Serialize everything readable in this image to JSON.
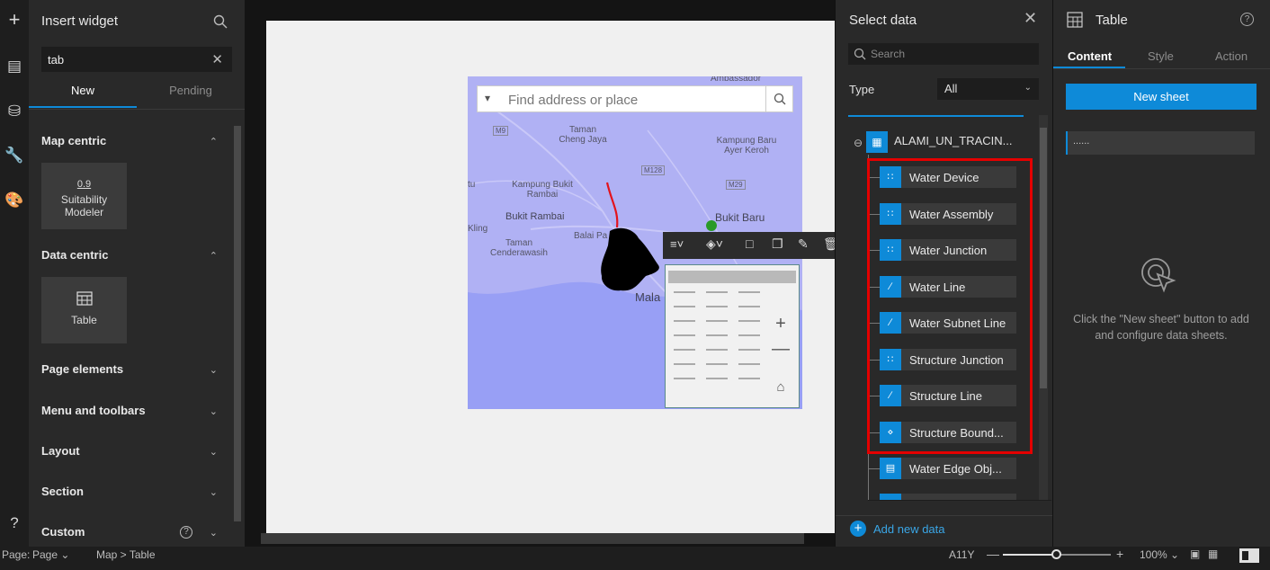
{
  "rail": {
    "icons": [
      "plus-icon",
      "page-icon",
      "data-icon",
      "tools-icon",
      "theme-icon",
      "help-icon"
    ]
  },
  "widget_panel": {
    "title": "Insert widget",
    "search_value": "tab",
    "tabs": [
      {
        "label": "New"
      },
      {
        "label": "Pending"
      }
    ],
    "sections": [
      {
        "label": "Map centric"
      },
      {
        "label": "Data centric"
      },
      {
        "label": "Page elements"
      },
      {
        "label": "Menu and toolbars"
      },
      {
        "label": "Layout"
      },
      {
        "label": "Section"
      },
      {
        "label": "Custom"
      }
    ],
    "tiles": [
      {
        "label": "Suitability Modeler",
        "icon_text": "0.9"
      },
      {
        "label": "Table"
      }
    ]
  },
  "map": {
    "search_placeholder": "Find address or place",
    "labels": [
      "Ambassador",
      "Taman Cheng Jaya",
      "Kampung Baru Ayer Keroh",
      "M9",
      "M128",
      "M29",
      "Kampung Bukit Rambai",
      "Bukit Rambai",
      "Bukit Baru",
      "Taman Cenderawasih",
      "Balai Pa",
      "Kling",
      "tu",
      "Mala"
    ]
  },
  "select_panel": {
    "title": "Select data",
    "search_placeholder": "Search",
    "type_label": "Type",
    "type_value": "All",
    "root_layer": "ALAMI_UN_TRACIN...",
    "layers": [
      {
        "label": "Water Device",
        "icon": "point-icon"
      },
      {
        "label": "Water Assembly",
        "icon": "point-icon"
      },
      {
        "label": "Water Junction",
        "icon": "point-icon"
      },
      {
        "label": "Water Line",
        "icon": "line-icon"
      },
      {
        "label": "Water Subnet Line",
        "icon": "line-icon"
      },
      {
        "label": "Structure Junction",
        "icon": "point-icon"
      },
      {
        "label": "Structure Line",
        "icon": "line-icon"
      },
      {
        "label": "Structure Bound...",
        "icon": "polygon-icon"
      },
      {
        "label": "Water Edge Obj...",
        "icon": "table-icon"
      }
    ],
    "add_data_label": "Add new data"
  },
  "settings_panel": {
    "title": "Table",
    "tabs": [
      {
        "label": "Content"
      },
      {
        "label": "Style"
      },
      {
        "label": "Action"
      }
    ],
    "new_sheet_label": "New sheet",
    "sheet_placeholder": "......",
    "empty_hint": "Click the \"New sheet\" button to add and configure data sheets."
  },
  "statusbar": {
    "page_label": "Page:",
    "page_value": "Page",
    "breadcrumb": [
      "Map",
      "Table"
    ],
    "device": "A11Y",
    "zoom": "100%"
  },
  "colors": {
    "accent": "#0e8ad8",
    "highlight_box": "#e40000",
    "map_bg": "#b0b1f4"
  }
}
